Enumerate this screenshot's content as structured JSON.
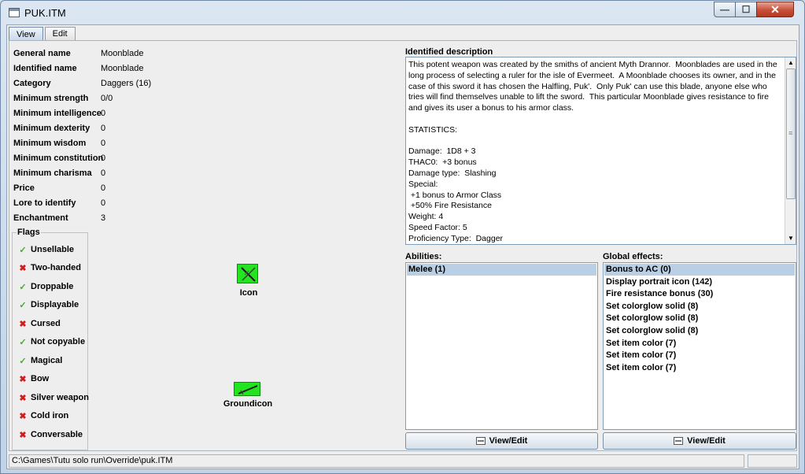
{
  "window": {
    "title": "PUK.ITM"
  },
  "tabs": [
    {
      "label": "View"
    },
    {
      "label": "Edit"
    }
  ],
  "properties": [
    {
      "label": "General name",
      "value": "Moonblade"
    },
    {
      "label": "Identified name",
      "value": "Moonblade"
    },
    {
      "label": "Category",
      "value": "Daggers (16)"
    },
    {
      "label": "Minimum strength",
      "value": "0/0"
    },
    {
      "label": "Minimum intelligence",
      "value": "0"
    },
    {
      "label": "Minimum dexterity",
      "value": "0"
    },
    {
      "label": "Minimum wisdom",
      "value": "0"
    },
    {
      "label": "Minimum constitution",
      "value": "0"
    },
    {
      "label": "Minimum charisma",
      "value": "0"
    },
    {
      "label": "Price",
      "value": "0"
    },
    {
      "label": "Lore to identify",
      "value": "0"
    },
    {
      "label": "Enchantment",
      "value": "3"
    }
  ],
  "flags": {
    "title": "Flags",
    "items": [
      {
        "label": "Unsellable",
        "checked": true
      },
      {
        "label": "Two-handed",
        "checked": false
      },
      {
        "label": "Droppable",
        "checked": true
      },
      {
        "label": "Displayable",
        "checked": true
      },
      {
        "label": "Cursed",
        "checked": false
      },
      {
        "label": "Not copyable",
        "checked": true
      },
      {
        "label": "Magical",
        "checked": true
      },
      {
        "label": "Bow",
        "checked": false
      },
      {
        "label": "Silver weapon",
        "checked": false
      },
      {
        "label": "Cold iron",
        "checked": false
      },
      {
        "label": "Conversable",
        "checked": false
      }
    ]
  },
  "images": {
    "icon_label": "Icon",
    "groundicon_label": "Groundicon"
  },
  "description": {
    "title": "Identified description",
    "text": "This potent weapon was created by the smiths of ancient Myth Drannor.  Moonblades are used in the long process of selecting a ruler for the isle of Evermeet.  A Moonblade chooses its owner, and in the case of this sword it has chosen the Halfling, Puk'.  Only Puk' can use this blade, anyone else who tries will find themselves unable to lift the sword.  This particular Moonblade gives resistance to fire and gives its user a bonus to his armor class.\n\nSTATISTICS:\n\nDamage:  1D8 + 3\nTHAC0:  +3 bonus\nDamage type:  Slashing\nSpecial:\n +1 bonus to Armor Class\n +50% Fire Resistance\nWeight: 4\nSpeed Factor: 5\nProficiency Type:  Dagger"
  },
  "abilities": {
    "title": "Abilities:",
    "items": [
      "Melee (1)"
    ],
    "button_label": "View/Edit"
  },
  "global_effects": {
    "title": "Global effects:",
    "items": [
      "Bonus to AC (0)",
      "Display portrait icon (142)",
      "Fire resistance bonus (30)",
      "Set colorglow solid (8)",
      "Set colorglow solid (8)",
      "Set colorglow solid (8)",
      "Set item color (7)",
      "Set item color (7)",
      "Set item color (7)"
    ],
    "button_label": "View/Edit"
  },
  "status": {
    "path": "C:\\Games\\Tutu solo run\\Override\\puk.ITM"
  },
  "colors": {
    "check_on": "#4ea334",
    "check_off": "#d11d1d",
    "selection": "#b8cfe5",
    "icon_green": "#22e41f"
  }
}
